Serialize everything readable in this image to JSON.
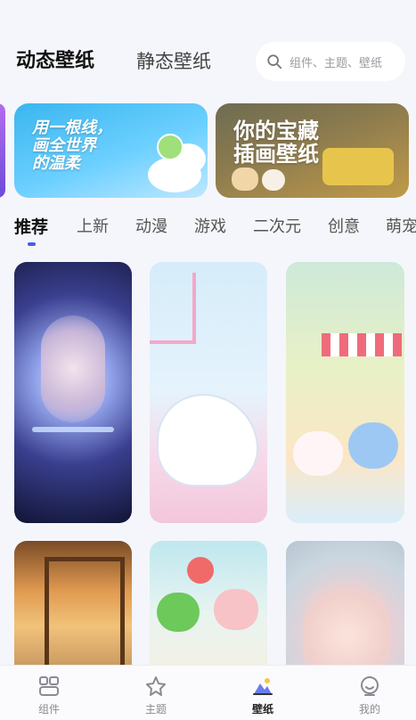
{
  "header": {
    "tabs": [
      {
        "label": "动态壁纸",
        "active": true
      },
      {
        "label": "静态壁纸",
        "active": false
      }
    ],
    "search": {
      "placeholder": "组件、主题、壁纸",
      "icon": "search-icon"
    }
  },
  "banners": [
    {
      "text": "用一根线，\n画全世界\n的温柔"
    },
    {
      "text": "你的宝藏\n插画壁纸"
    }
  ],
  "categories": [
    {
      "label": "推荐",
      "active": true
    },
    {
      "label": "上新"
    },
    {
      "label": "动漫"
    },
    {
      "label": "游戏"
    },
    {
      "label": "二次元"
    },
    {
      "label": "创意"
    },
    {
      "label": "萌宠"
    }
  ],
  "bottom_nav": [
    {
      "label": "组件",
      "icon": "widgets-icon",
      "active": false
    },
    {
      "label": "主题",
      "icon": "theme-icon",
      "active": false
    },
    {
      "label": "壁纸",
      "icon": "wallpaper-icon",
      "active": true
    },
    {
      "label": "我的",
      "icon": "profile-icon",
      "active": false
    }
  ],
  "colors": {
    "accent": "#4c5ce6",
    "background": "#f5f6fb"
  }
}
